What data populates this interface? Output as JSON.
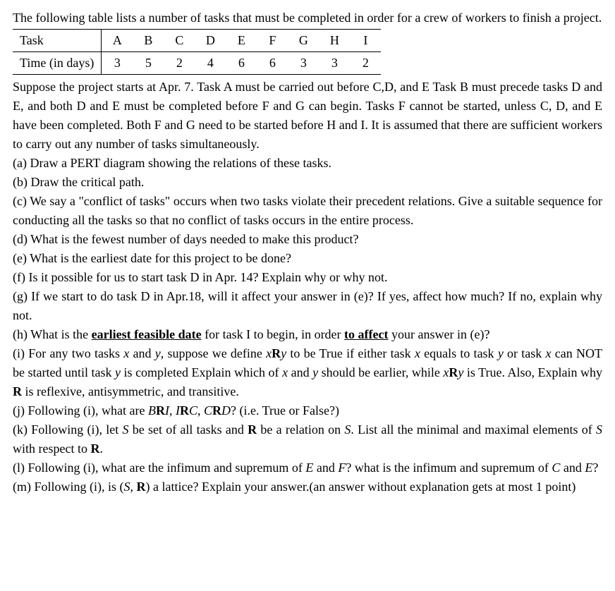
{
  "intro1": "The following table lists a number of tasks that must be completed in order for a crew of workers to finish a project.",
  "table": {
    "label_task": "Task",
    "label_time": "Time (in days)",
    "cols": [
      "A",
      "B",
      "C",
      "D",
      "E",
      "F",
      "G",
      "H",
      "I"
    ],
    "times": [
      "3",
      "5",
      "2",
      "4",
      "6",
      "6",
      "3",
      "3",
      "2"
    ]
  },
  "intro2": "Suppose the project starts at Apr. 7. Task A must be carried out before C,D, and E Task B must precede tasks D and E, and both D and E must be completed before F and G can begin. Tasks F cannot be started, unless C, D, and E have been completed. Both F and G need to be started before H and I. It is assumed that there are sufficient workers to carry out any number of tasks simultaneously.",
  "qa": "(a) Draw a PERT diagram showing the relations of these tasks.",
  "qb": "(b) Draw the critical path.",
  "qc": "(c) We say a \"conflict of tasks\" occurs when two tasks violate their precedent relations. Give a suitable sequence for conducting all the tasks so that no conflict of tasks occurs in the entire process.",
  "qd": "(d) What is the fewest number of days needed to make this product?",
  "qe": "(e) What is the earliest date for this project to be done?",
  "qf": "(f) Is it possible for us to start task D in Apr. 14? Explain why or why not.",
  "qg": "(g) If we start to do task D in Apr.18, will it affect your answer in (e)? If yes, affect how much? If no, explain why not.",
  "qh_1": "(h) What is the ",
  "qh_2": "earliest feasible date",
  "qh_3": " for task I to begin, in order ",
  "qh_4": "to affect",
  "qh_5": " your answer in (e)?",
  "qi_1": "(i)  For any two tasks ",
  "x": "x",
  "qi_2": " and ",
  "y": "y",
  "qi_3": ", suppose we define ",
  "xRy": "x",
  "R": "R",
  "qi_4": " to be True if either task ",
  "qi_5": " equals to task ",
  "qi_6": " or task ",
  "qi_7": " can NOT be started until task ",
  "qi_8": " is completed  Explain which of ",
  "qi_9": " should be earlier, while ",
  "qi_10": " is True.  Also, Explain why ",
  "qi_11": " is reflexive, antisymmetric, and transitive.",
  "qj_1": "(j)  Following (i), what are ",
  "BRI": "B",
  "I": "I",
  "qj_2": ", ",
  "IRC": "I",
  "C": "C",
  "qj_3": ", ",
  "CRD": "C",
  "D": "D",
  "qj_4": "? (i.e. True or False?)",
  "qk_1": "(k)  Following (i), let ",
  "S": "S",
  "qk_2": " be set of all tasks and ",
  "qk_3": " be a relation on ",
  "qk_4": ". List all the minimal and maximal elements of ",
  "qk_5": " with respect to ",
  "dot": ".",
  "ql_1": "(l)  Following (i), what are the infimum and supremum of ",
  "E": "E",
  "ql_2": " and ",
  "F": "F",
  "ql_3": "?  what is the infimum and supremum of ",
  "ql_4": " and ",
  "ql_5": "?",
  "qm_1": "(m)  Following (i), is (",
  "qm_2": ", ",
  "qm_3": ") a lattice? Explain your answer.(an answer without explanation gets at most 1 point)"
}
